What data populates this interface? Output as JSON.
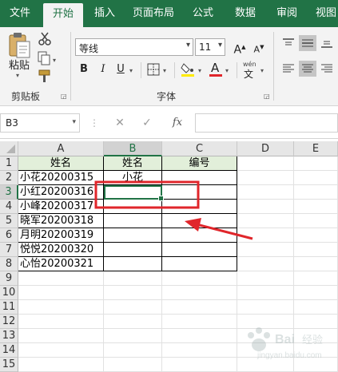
{
  "ribbon_tabs": [
    "文件",
    "开始",
    "插入",
    "页面布局",
    "公式",
    "数据",
    "审阅",
    "视图"
  ],
  "active_tab": "开始",
  "clipboard": {
    "paste_label": "粘贴",
    "group_label": "剪贴板"
  },
  "font": {
    "name": "等线",
    "size": "11",
    "group_label": "字体",
    "bold": "B",
    "italic": "I",
    "underline": "U",
    "font_color_glyph": "A",
    "phonetic_glyph": "wén"
  },
  "formula_bar": {
    "name_box": "B3",
    "cancel": "✕",
    "enter": "✓",
    "fx": "fx",
    "value": ""
  },
  "columns": [
    "A",
    "B",
    "C",
    "D",
    "E"
  ],
  "rows": [
    "1",
    "2",
    "3",
    "4",
    "5",
    "6",
    "7",
    "8",
    "9",
    "10",
    "11",
    "12",
    "13",
    "14",
    "15"
  ],
  "sheet": {
    "headers": {
      "A": "姓名",
      "B": "姓名",
      "C": "编号"
    },
    "names": [
      "小花20200315",
      "小红20200316",
      "小峰20200317",
      "晓军20200318",
      "月明20200319",
      "悦悦20200320",
      "心怡20200321"
    ],
    "b2": "小花",
    "selected_cell": "B3"
  },
  "colors": {
    "excel_green": "#217346",
    "header_fill": "#e2efda",
    "annotation_red": "#e0262b"
  },
  "watermark": "Baidu经验 jingyan.baidu.com"
}
